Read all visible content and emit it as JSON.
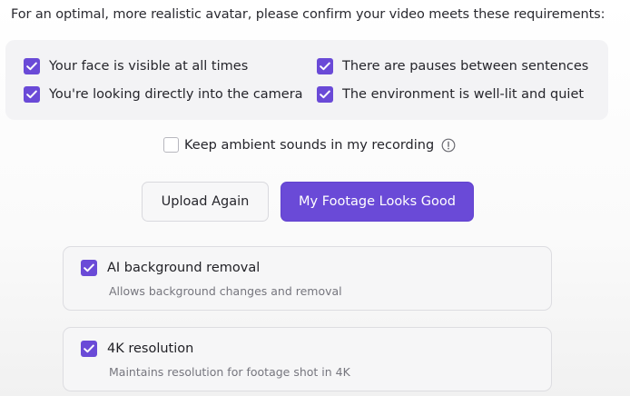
{
  "intro_text": "For an optimal, more realistic avatar, please confirm your video meets these requirements:",
  "requirements": [
    {
      "label": "Your face is visible at all times",
      "checked": true
    },
    {
      "label": "There are pauses between sentences",
      "checked": true
    },
    {
      "label": "You're looking directly into the camera",
      "checked": true
    },
    {
      "label": "The environment is well-lit and quiet",
      "checked": true
    }
  ],
  "ambient": {
    "label": "Keep ambient sounds in my recording",
    "checked": false,
    "icon": "info-icon"
  },
  "buttons": {
    "upload_again": "Upload Again",
    "footage_good": "My Footage Looks Good"
  },
  "options": [
    {
      "title": "AI background removal",
      "description": "Allows background changes and removal",
      "checked": true
    },
    {
      "title": "4K resolution",
      "description": "Maintains resolution for footage shot in 4K",
      "checked": true
    }
  ],
  "colors": {
    "accent": "#6a4ad7",
    "panel_bg": "#f3f3f5",
    "muted_text": "#76767e"
  }
}
